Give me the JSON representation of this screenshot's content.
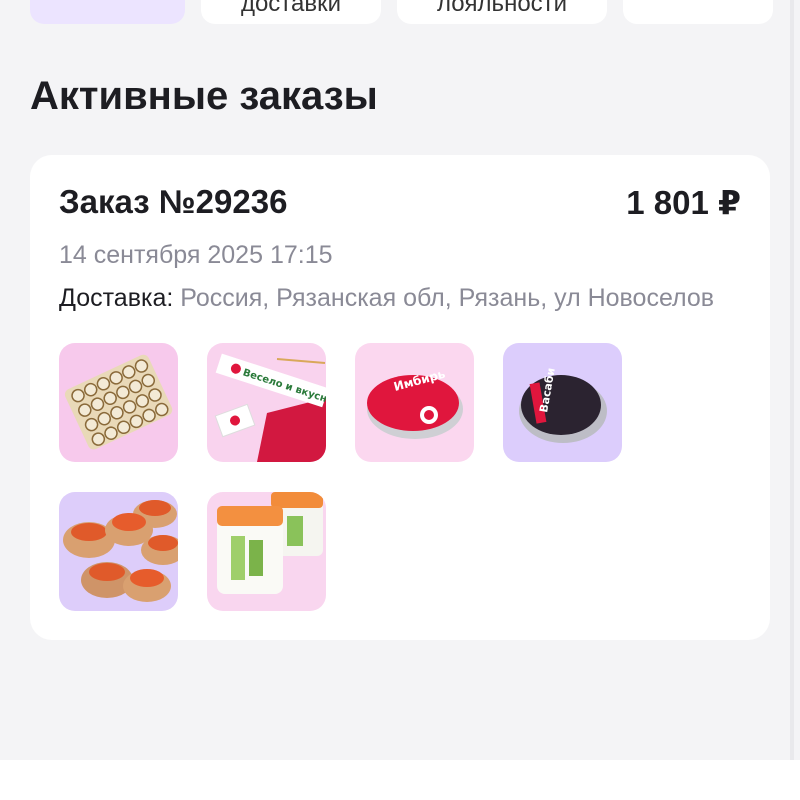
{
  "tabs": [
    {
      "label": ""
    },
    {
      "label": "доставки"
    },
    {
      "label": "лояльности"
    },
    {
      "label": ""
    }
  ],
  "section_title": "Активные заказы",
  "order": {
    "number": "Заказ №29236",
    "total": "1 801 ₽",
    "date": "14 сентября 2025 17:15",
    "delivery_label": "Доставка:",
    "delivery_address": "Россия, Рязанская обл, Рязань, ул Новоселов",
    "items": [
      {
        "name": "sushi-set-icon",
        "bg": "#f7c9ec"
      },
      {
        "name": "chopsticks-pack-icon",
        "bg": "#f9d3ee",
        "text": "Весело и вкусно!"
      },
      {
        "name": "ginger-sauce-icon",
        "bg": "#fbd7ef",
        "text": "Имбирь"
      },
      {
        "name": "wasabi-sauce-icon",
        "bg": "#dccdfc",
        "text": "Васаби"
      },
      {
        "name": "baked-rolls-icon",
        "bg": "#ddcdfa"
      },
      {
        "name": "salmon-rolls-icon",
        "bg": "#f9d6ef"
      }
    ]
  },
  "colors": {
    "background": "#f4f4f6",
    "card": "#ffffff",
    "active_tab": "#ece4ff",
    "muted_text": "#8a8a96",
    "brand_red": "#e0163d"
  }
}
